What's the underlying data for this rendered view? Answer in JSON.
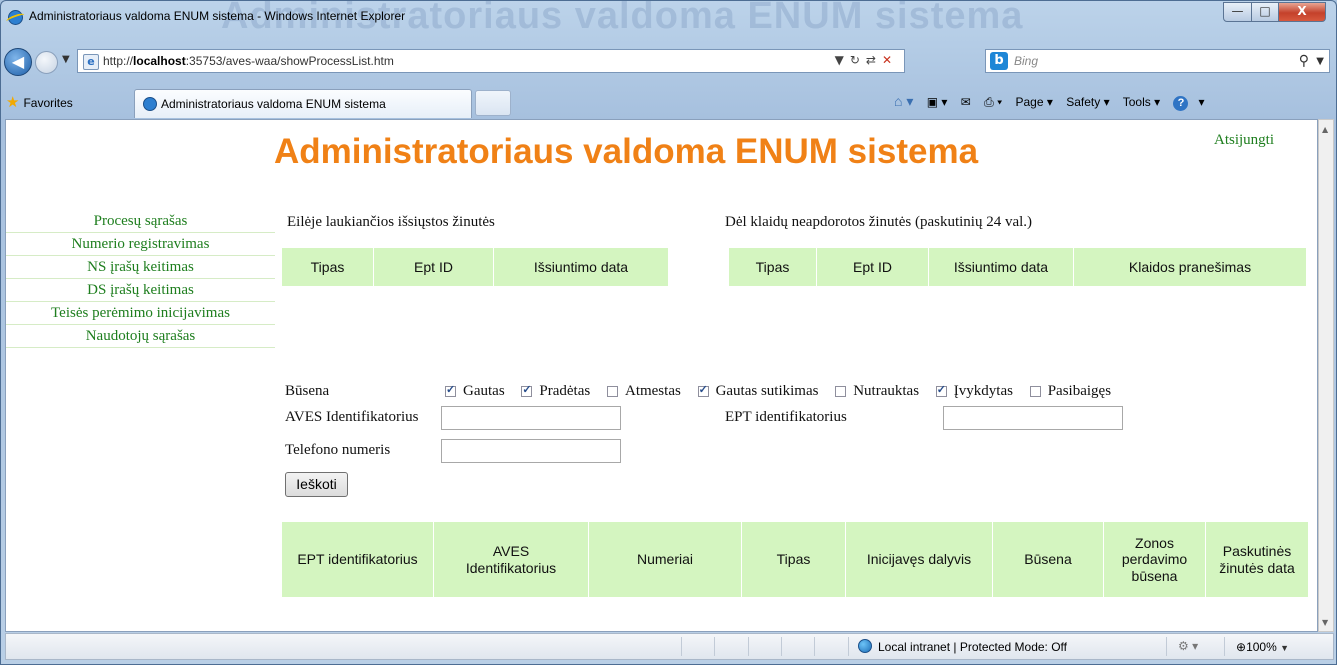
{
  "window": {
    "title": "Administratoriaus valdoma ENUM sistema - Windows Internet Explorer",
    "ghost_title": "Administratoriaus valdoma ENUM sistema",
    "min_label": "—",
    "max_label": "□",
    "close_label": "X"
  },
  "nav": {
    "url_prefix": "http://",
    "url_host": "localhost",
    "url_rest": ":35753/aves-waa/showProcessList.htm",
    "search_placeholder": "Bing"
  },
  "favorites": {
    "label": "Favorites",
    "tab_title": "Administratoriaus valdoma ENUM sistema",
    "commands": [
      "Page ▾",
      "Safety ▾",
      "Tools ▾"
    ]
  },
  "page": {
    "title": "Administratoriaus valdoma ENUM sistema",
    "logout": "Atsijungti",
    "menu": [
      "Procesų sąrašas",
      "Numerio registravimas",
      "NS įrašų keitimas",
      "DS įrašų keitimas",
      "Teisės perėmimo inicijavimas",
      "Naudotojų sąrašas"
    ],
    "queue": {
      "heading": "Eilėje laukiančios išsiųstos žinutės",
      "columns": [
        "Tipas",
        "Ept ID",
        "Išsiuntimo data"
      ]
    },
    "errors": {
      "heading": "Dėl klaidų neapdorotos žinutės (paskutinių 24 val.)",
      "columns": [
        "Tipas",
        "Ept ID",
        "Išsiuntimo data",
        "Klaidos pranešimas"
      ]
    },
    "filter": {
      "status_label": "Būsena",
      "statuses": [
        {
          "label": "Gautas",
          "checked": true
        },
        {
          "label": "Pradėtas",
          "checked": true
        },
        {
          "label": "Atmestas",
          "checked": false
        },
        {
          "label": "Gautas sutikimas",
          "checked": true
        },
        {
          "label": "Nutrauktas",
          "checked": false
        },
        {
          "label": "Įvykdytas",
          "checked": true
        },
        {
          "label": "Pasibaigęs",
          "checked": false
        }
      ],
      "aves_label": "AVES Identifikatorius",
      "aves_value": "",
      "ept_label": "EPT identifikatorius",
      "ept_value": "",
      "phone_label": "Telefono numeris",
      "phone_value": "",
      "search_button": "Ieškoti"
    },
    "results": {
      "columns": [
        "EPT identifikatorius",
        "AVES Identifikatorius",
        "Numeriai",
        "Tipas",
        "Inicijavęs dalyvis",
        "Būsena",
        "Zonos perdavimo būsena",
        "Paskutinės žinutės data"
      ]
    }
  },
  "statusbar": {
    "zone": "Local intranet | Protected Mode: Off",
    "zoom": "100%"
  }
}
